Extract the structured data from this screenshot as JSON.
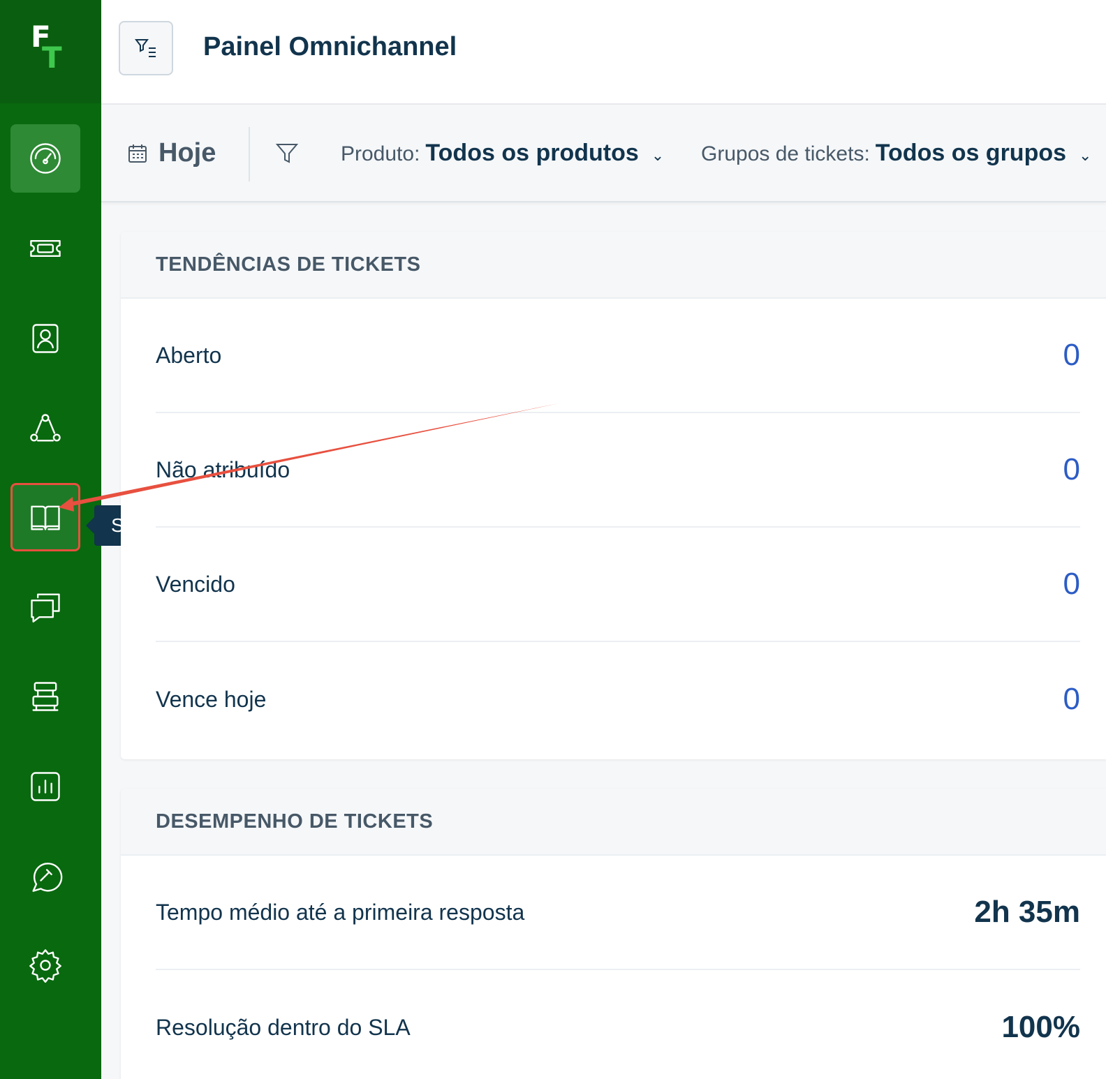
{
  "app": {
    "logo_primary": "F",
    "logo_secondary": "T"
  },
  "sidebar": {
    "items": [
      {
        "id": "dashboard",
        "icon": "dashboard-gauge-icon",
        "active": true
      },
      {
        "id": "tickets",
        "icon": "ticket-icon"
      },
      {
        "id": "contacts",
        "icon": "contact-card-icon"
      },
      {
        "id": "groups",
        "icon": "group-network-icon"
      },
      {
        "id": "solutions",
        "icon": "book-icon",
        "highlighted": true
      },
      {
        "id": "conversations",
        "icon": "chat-bubbles-icon"
      },
      {
        "id": "admin",
        "icon": "admin-tools-icon"
      },
      {
        "id": "reports",
        "icon": "bar-chart-icon"
      },
      {
        "id": "help",
        "icon": "compass-wrench-icon"
      },
      {
        "id": "settings",
        "icon": "gear-icon"
      }
    ],
    "tooltip": "Soluções"
  },
  "header": {
    "title": "Painel Omnichannel"
  },
  "filters": {
    "date": "Hoje",
    "product_label": "Produto:",
    "product_value": "Todos os produtos",
    "groups_label": "Grupos de tickets:",
    "groups_value": "Todos os grupos"
  },
  "trends": {
    "title": "TENDÊNCIAS DE TICKETS",
    "rows": [
      {
        "label": "Aberto",
        "value": "0"
      },
      {
        "label": "Não atribuído",
        "value": "0"
      },
      {
        "label": "Vencido",
        "value": "0"
      },
      {
        "label": "Vence hoje",
        "value": "0"
      }
    ]
  },
  "performance": {
    "title": "DESEMPENHO DE TICKETS",
    "rows": [
      {
        "label": "Tempo médio até a primeira resposta",
        "value": "2h 35m"
      },
      {
        "label": "Resolução dentro do SLA",
        "value": "100%"
      }
    ]
  },
  "colors": {
    "sidebar": "#09690f",
    "accent_value": "#2c5cc5",
    "annotation": "#e8503f"
  }
}
